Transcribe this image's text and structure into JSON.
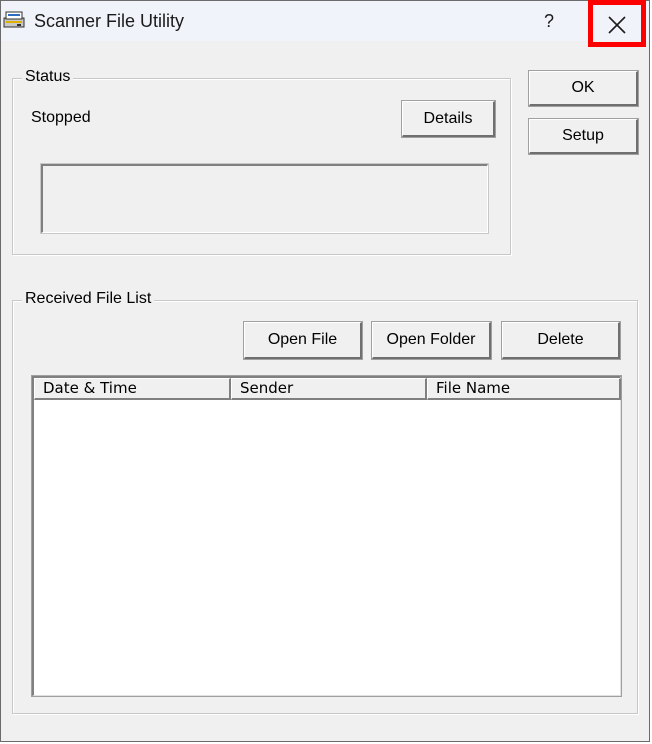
{
  "window": {
    "title": "Scanner File Utility",
    "help_label": "?",
    "colors": {
      "close_highlight": "#ff0000",
      "face": "#f0f0f0"
    }
  },
  "status": {
    "group_label": "Status",
    "state_text": "Stopped",
    "details_label": "Details"
  },
  "side_buttons": {
    "ok_label": "OK",
    "setup_label": "Setup"
  },
  "received": {
    "group_label": "Received File List",
    "open_file_label": "Open File",
    "open_folder_label": "Open Folder",
    "delete_label": "Delete",
    "columns": [
      "Date & Time",
      "Sender",
      "File Name"
    ],
    "rows": []
  }
}
